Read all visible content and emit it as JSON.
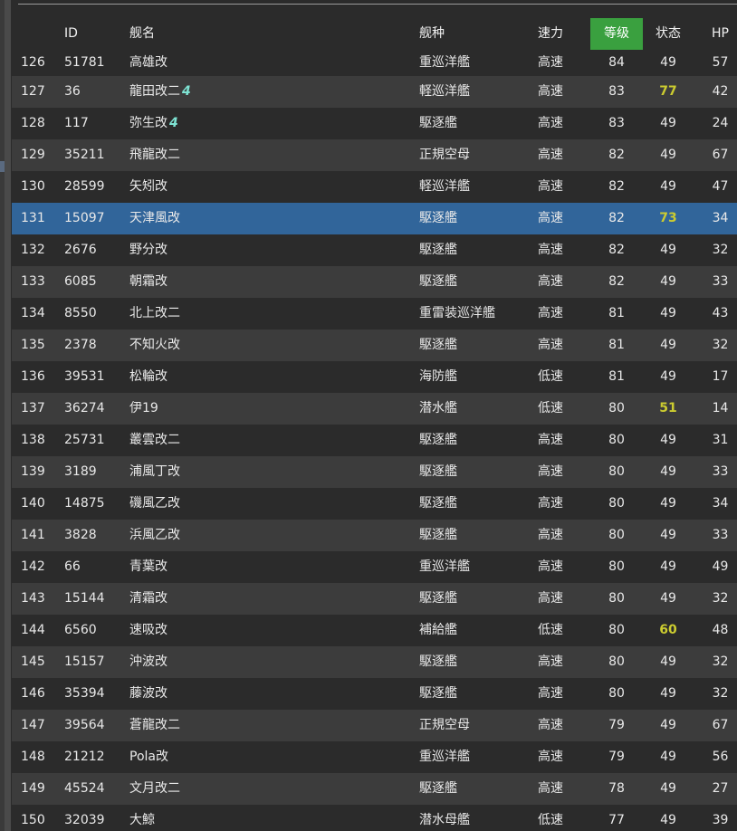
{
  "headers": {
    "no": "",
    "id": "ID",
    "name": "舰名",
    "type": "舰种",
    "speed": "速力",
    "level": "等级",
    "cond": "状态",
    "hp": "HP"
  },
  "colors": {
    "sort_active": "#3aa03f",
    "selected_row": "#31659a",
    "cond_highlight": "#cccc30",
    "mark_icon": "#7ee3d3"
  },
  "rows": [
    {
      "no": "126",
      "id": "51781",
      "name": "高雄改",
      "mark": "",
      "type": "重巡洋艦",
      "speed": "高速",
      "level": "84",
      "cond": "49",
      "hp": "57"
    },
    {
      "no": "127",
      "id": "36",
      "name": "龍田改二",
      "mark": "4",
      "type": "軽巡洋艦",
      "speed": "高速",
      "level": "83",
      "cond": "77",
      "hp": "42"
    },
    {
      "no": "128",
      "id": "117",
      "name": "弥生改",
      "mark": "4",
      "type": "駆逐艦",
      "speed": "高速",
      "level": "83",
      "cond": "49",
      "hp": "24"
    },
    {
      "no": "129",
      "id": "35211",
      "name": "飛龍改二",
      "mark": "",
      "type": "正規空母",
      "speed": "高速",
      "level": "82",
      "cond": "49",
      "hp": "67"
    },
    {
      "no": "130",
      "id": "28599",
      "name": "矢矧改",
      "mark": "",
      "type": "軽巡洋艦",
      "speed": "高速",
      "level": "82",
      "cond": "49",
      "hp": "47"
    },
    {
      "no": "131",
      "id": "15097",
      "name": "天津風改",
      "mark": "",
      "type": "駆逐艦",
      "speed": "高速",
      "level": "82",
      "cond": "73",
      "hp": "34"
    },
    {
      "no": "132",
      "id": "2676",
      "name": "野分改",
      "mark": "",
      "type": "駆逐艦",
      "speed": "高速",
      "level": "82",
      "cond": "49",
      "hp": "32"
    },
    {
      "no": "133",
      "id": "6085",
      "name": "朝霜改",
      "mark": "",
      "type": "駆逐艦",
      "speed": "高速",
      "level": "82",
      "cond": "49",
      "hp": "33"
    },
    {
      "no": "134",
      "id": "8550",
      "name": "北上改二",
      "mark": "",
      "type": "重雷装巡洋艦",
      "speed": "高速",
      "level": "81",
      "cond": "49",
      "hp": "43"
    },
    {
      "no": "135",
      "id": "2378",
      "name": "不知火改",
      "mark": "",
      "type": "駆逐艦",
      "speed": "高速",
      "level": "81",
      "cond": "49",
      "hp": "32"
    },
    {
      "no": "136",
      "id": "39531",
      "name": "松輪改",
      "mark": "",
      "type": "海防艦",
      "speed": "低速",
      "level": "81",
      "cond": "49",
      "hp": "17"
    },
    {
      "no": "137",
      "id": "36274",
      "name": "伊19",
      "mark": "",
      "type": "潜水艦",
      "speed": "低速",
      "level": "80",
      "cond": "51",
      "hp": "14"
    },
    {
      "no": "138",
      "id": "25731",
      "name": "叢雲改二",
      "mark": "",
      "type": "駆逐艦",
      "speed": "高速",
      "level": "80",
      "cond": "49",
      "hp": "31"
    },
    {
      "no": "139",
      "id": "3189",
      "name": "浦風丁改",
      "mark": "",
      "type": "駆逐艦",
      "speed": "高速",
      "level": "80",
      "cond": "49",
      "hp": "33"
    },
    {
      "no": "140",
      "id": "14875",
      "name": "磯風乙改",
      "mark": "",
      "type": "駆逐艦",
      "speed": "高速",
      "level": "80",
      "cond": "49",
      "hp": "34"
    },
    {
      "no": "141",
      "id": "3828",
      "name": "浜風乙改",
      "mark": "",
      "type": "駆逐艦",
      "speed": "高速",
      "level": "80",
      "cond": "49",
      "hp": "33"
    },
    {
      "no": "142",
      "id": "66",
      "name": "青葉改",
      "mark": "",
      "type": "重巡洋艦",
      "speed": "高速",
      "level": "80",
      "cond": "49",
      "hp": "49"
    },
    {
      "no": "143",
      "id": "15144",
      "name": "清霜改",
      "mark": "",
      "type": "駆逐艦",
      "speed": "高速",
      "level": "80",
      "cond": "49",
      "hp": "32"
    },
    {
      "no": "144",
      "id": "6560",
      "name": "速吸改",
      "mark": "",
      "type": "補給艦",
      "speed": "低速",
      "level": "80",
      "cond": "60",
      "hp": "48"
    },
    {
      "no": "145",
      "id": "15157",
      "name": "沖波改",
      "mark": "",
      "type": "駆逐艦",
      "speed": "高速",
      "level": "80",
      "cond": "49",
      "hp": "32"
    },
    {
      "no": "146",
      "id": "35394",
      "name": "藤波改",
      "mark": "",
      "type": "駆逐艦",
      "speed": "高速",
      "level": "80",
      "cond": "49",
      "hp": "32"
    },
    {
      "no": "147",
      "id": "39564",
      "name": "蒼龍改二",
      "mark": "",
      "type": "正規空母",
      "speed": "高速",
      "level": "79",
      "cond": "49",
      "hp": "67"
    },
    {
      "no": "148",
      "id": "21212",
      "name": "Pola改",
      "mark": "",
      "type": "重巡洋艦",
      "speed": "高速",
      "level": "79",
      "cond": "49",
      "hp": "56"
    },
    {
      "no": "149",
      "id": "45524",
      "name": "文月改二",
      "mark": "",
      "type": "駆逐艦",
      "speed": "高速",
      "level": "78",
      "cond": "49",
      "hp": "27"
    },
    {
      "no": "150",
      "id": "32039",
      "name": "大鯨",
      "mark": "",
      "type": "潜水母艦",
      "speed": "低速",
      "level": "77",
      "cond": "49",
      "hp": "39"
    }
  ]
}
